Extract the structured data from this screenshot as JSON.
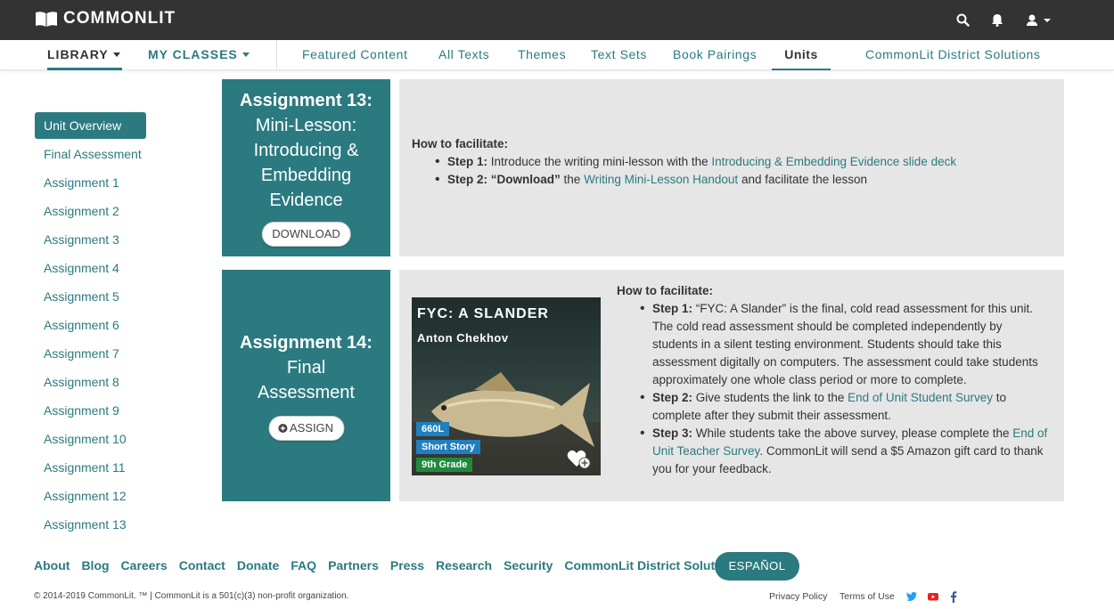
{
  "brand": {
    "name": "COMMONLIT"
  },
  "topbar": {
    "icons": [
      "search-icon",
      "bell-icon",
      "user-icon"
    ]
  },
  "nav": {
    "library": "LIBRARY",
    "my_classes": "MY CLASSES",
    "featured": "Featured Content",
    "all_texts": "All Texts",
    "themes": "Themes",
    "text_sets": "Text Sets",
    "book_pairings": "Book Pairings",
    "units": "Units",
    "district": "CommonLit District Solutions"
  },
  "sidebar": {
    "items": [
      "Unit Overview",
      "Final Assessment",
      "Assignment 1",
      "Assignment 2",
      "Assignment 3",
      "Assignment 4",
      "Assignment 5",
      "Assignment 6",
      "Assignment 7",
      "Assignment 8",
      "Assignment 9",
      "Assignment 10",
      "Assignment 11",
      "Assignment 12",
      "Assignment 13"
    ]
  },
  "assignment13": {
    "title_bold": "Assignment 13:",
    "title_rest": [
      "Mini-Lesson:",
      "Introducing &",
      "Embedding",
      "Evidence"
    ],
    "button": "DOWNLOAD",
    "how": "How to facilitate:",
    "step1_label": "Step 1:",
    "step1_text": "Introduce the writing mini-lesson with the",
    "step1_link": "Introducing & Embedding Evidence slide deck",
    "step2_label": "Step 2: “Download”",
    "step2_text": "the",
    "step2_link": "Writing Mini-Lesson Handout",
    "step2_text2": "and facilitate the lesson"
  },
  "assignment14": {
    "title_bold": "Assignment 14:",
    "title_rest": [
      "Final",
      "Assessment"
    ],
    "button": "ASSIGN",
    "text_card": {
      "title": "FYC: A SLANDER",
      "author": "Anton Chekhov",
      "lexile": "660L",
      "genre": "Short Story",
      "grade": "9th Grade"
    },
    "how": "How to facilitate:",
    "step1_label": "Step 1:",
    "step1_lines": [
      "“FYC: A Slander” is the final, cold read assessment for this unit.",
      "The cold read assessment should be completed independently by",
      "students in a silent testing environment. Students should take this",
      "assessment digitally on computers. The assessment could take students",
      "approximately one whole class period or more to complete."
    ],
    "step2_label": "Step 2:",
    "step2_text": "Give students the link to the",
    "step2_link": "End of Unit Student Survey",
    "step2_text2": "to",
    "step2_line2": "complete after they submit their assessment.",
    "step3_label": "Step 3:",
    "step3_text": "While students take the above survey, please complete the",
    "step3_link1": "End of",
    "step3_link2": "Unit Teacher Survey",
    "step3_text2": ". CommonLit will send a $5 Amazon gift card to thank",
    "step3_line3": "you for your feedback."
  },
  "footer": {
    "links": [
      "About",
      "Blog",
      "Careers",
      "Contact",
      "Donate",
      "FAQ",
      "Partners",
      "Press",
      "Research",
      "Security",
      "CommonLit District Solutions"
    ],
    "espanol": "ESPAÑOL",
    "copyright": "© 2014-2019 CommonLit. ™ | CommonLit is a 501(c)(3) non-profit organization.",
    "privacy": "Privacy Policy",
    "terms": "Terms of Use",
    "social_icons": [
      "twitter-icon",
      "youtube-icon",
      "facebook-icon"
    ]
  },
  "colors": {
    "teal": "#2b7a80",
    "topbar": "#333333",
    "panel": "#e6e6e6",
    "lexile": "#1f7fbf",
    "genre": "#1f7fbf",
    "grade": "#1e8a3c"
  }
}
